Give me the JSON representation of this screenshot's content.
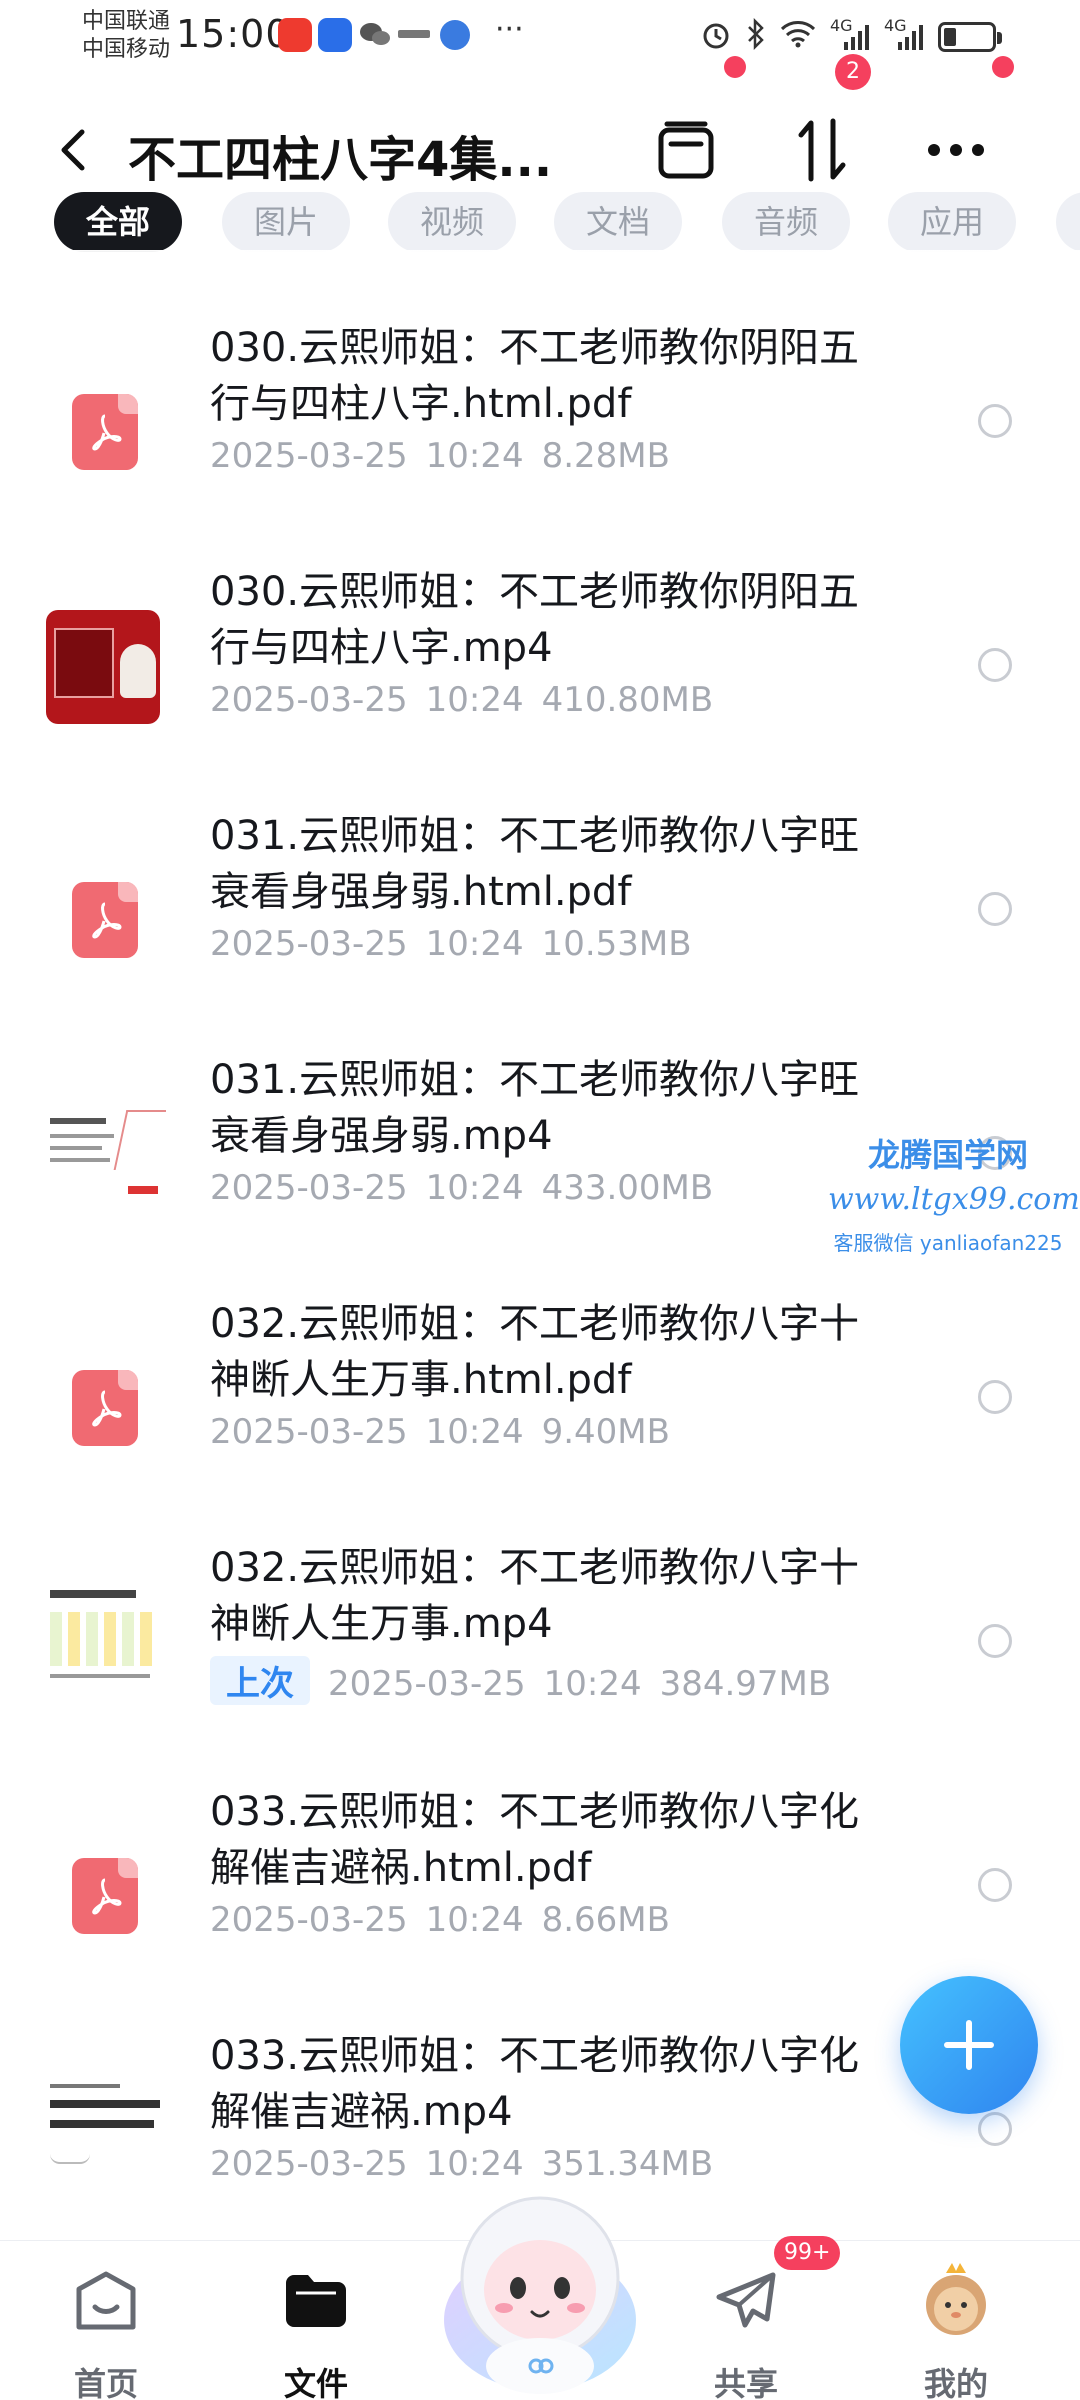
{
  "status": {
    "carrier1": "中国联通",
    "carrier2": "中国移动",
    "time": "15:00",
    "dots": "···",
    "net1": "4G",
    "net2": "4G"
  },
  "header": {
    "title": "不工四柱八字4集...",
    "sort_badge": "2"
  },
  "tabs": [
    "全部",
    "图片",
    "视频",
    "文档",
    "音频",
    "应用"
  ],
  "files": [
    {
      "name": "030.云熙师姐：不工老师教你阴阳五行与四柱八字.html.pdf",
      "date": "2025-03-25",
      "time": "10:24",
      "size": "8.28MB",
      "kind": "pdf",
      "tag": ""
    },
    {
      "name": "030.云熙师姐：不工老师教你阴阳五行与四柱八字.mp4",
      "date": "2025-03-25",
      "time": "10:24",
      "size": "410.80MB",
      "kind": "video-red",
      "tag": ""
    },
    {
      "name": "031.云熙师姐：不工老师教你八字旺衰看身强身弱.html.pdf",
      "date": "2025-03-25",
      "time": "10:24",
      "size": "10.53MB",
      "kind": "pdf",
      "tag": ""
    },
    {
      "name": "031.云熙师姐：不工老师教你八字旺衰看身强身弱.mp4",
      "date": "2025-03-25",
      "time": "10:24",
      "size": "433.00MB",
      "kind": "video-white",
      "tag": ""
    },
    {
      "name": "032.云熙师姐：不工老师教你八字十神断人生万事.html.pdf",
      "date": "2025-03-25",
      "time": "10:24",
      "size": "9.40MB",
      "kind": "pdf",
      "tag": ""
    },
    {
      "name": "032.云熙师姐：不工老师教你八字十神断人生万事.mp4",
      "date": "2025-03-25",
      "time": "10:24",
      "size": "384.97MB",
      "kind": "video-table",
      "tag": "上次"
    },
    {
      "name": "033.云熙师姐：不工老师教你八字化解催吉避祸.html.pdf",
      "date": "2025-03-25",
      "time": "10:24",
      "size": "8.66MB",
      "kind": "pdf",
      "tag": ""
    },
    {
      "name": "033.云熙师姐：不工老师教你八字化解催吉避祸.mp4",
      "date": "2025-03-25",
      "time": "10:24",
      "size": "351.34MB",
      "kind": "video-white",
      "tag": ""
    }
  ],
  "watermark": {
    "line1": "龙腾国学网",
    "line2": "www.ltgx99.com",
    "line3": "客服微信 yanliaofan225"
  },
  "nav": {
    "items": [
      "首页",
      "文件",
      "共享",
      "我的"
    ],
    "share_badge": "99+"
  },
  "colors": {
    "accent": "#2f86f0",
    "pdf": "#f06a72",
    "badge": "#f5405e",
    "fab": "#2f84ef"
  }
}
